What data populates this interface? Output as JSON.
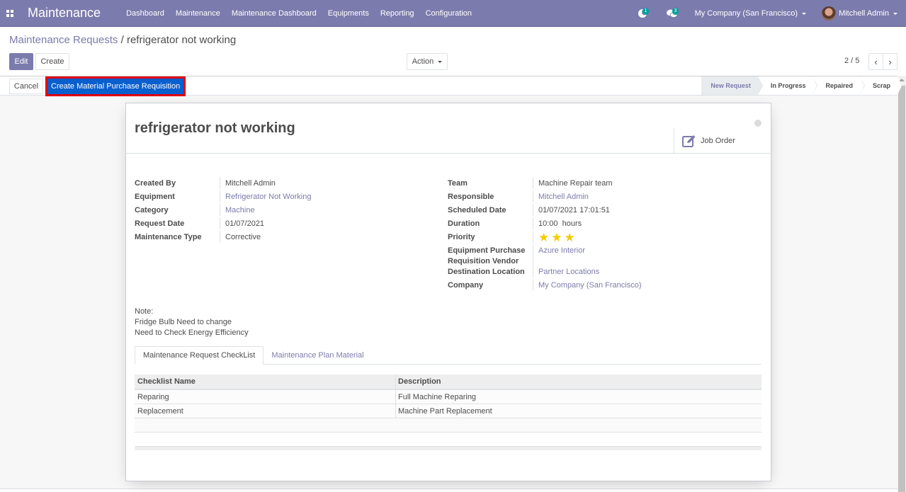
{
  "navbar": {
    "app_name": "Maintenance",
    "menu": [
      "Dashboard",
      "Maintenance",
      "Maintenance Dashboard",
      "Equipments",
      "Reporting",
      "Configuration"
    ],
    "activities_badge": "1",
    "messages_badge": "3",
    "company": "My Company (San Francisco)",
    "user": "Mitchell Admin"
  },
  "breadcrumb": {
    "parent": "Maintenance Requests",
    "separator": "/",
    "current": "refrigerator not working"
  },
  "toolbar": {
    "edit_label": "Edit",
    "create_label": "Create",
    "action_label": "Action",
    "pager_value": "2 / 5",
    "prev_icon": "‹",
    "next_icon": "›"
  },
  "statusbar": {
    "cancel_label": "Cancel",
    "create_mpr_label": "Create Material Purchase Requisition",
    "stages": [
      "New Request",
      "In Progress",
      "Repaired",
      "Scrap"
    ],
    "active_stage": "New Request"
  },
  "form": {
    "title": "refrigerator not working",
    "smart_button": {
      "icon": "edit-icon",
      "label": "Job Order"
    },
    "left_fields": [
      {
        "label": "Created By",
        "value": "Mitchell Admin",
        "link": false
      },
      {
        "label": "Equipment",
        "value": "Refrigerator Not Working",
        "link": true
      },
      {
        "label": "Category",
        "value": "Machine",
        "link": true
      },
      {
        "label": "Request Date",
        "value": "01/07/2021",
        "link": false
      },
      {
        "label": "Maintenance Type",
        "value": "Corrective",
        "link": false
      }
    ],
    "right_fields": {
      "team": {
        "label": "Team",
        "value": "Machine Repair team"
      },
      "responsible": {
        "label": "Responsible",
        "value": "Mitchell Admin"
      },
      "scheduled_date": {
        "label": "Scheduled Date",
        "value": "01/07/2021 17:01:51"
      },
      "duration": {
        "label": "Duration",
        "value": "10:00  hours"
      },
      "priority": {
        "label": "Priority",
        "stars": 3,
        "max": 3
      },
      "vendor": {
        "label": "Equipment Purchase Requisition Vendor",
        "value": "Azure Interior"
      },
      "destination": {
        "label": "Destination Location",
        "value": "Partner Locations"
      },
      "company": {
        "label": "Company",
        "value": "My Company (San Francisco)"
      }
    },
    "note": [
      "Note:",
      "Fridge Bulb Need to change",
      "Need to Check Energy Efficiency"
    ],
    "tabs": [
      "Maintenance Request CheckList",
      "Maintenance Plan Material"
    ],
    "active_tab": "Maintenance Request CheckList",
    "checklist": {
      "columns": [
        "Checklist Name",
        "Description"
      ],
      "rows": [
        [
          "Reparing",
          "Full Machine Reparing"
        ],
        [
          "Replacement",
          "Machine Part Replacement"
        ]
      ]
    }
  }
}
